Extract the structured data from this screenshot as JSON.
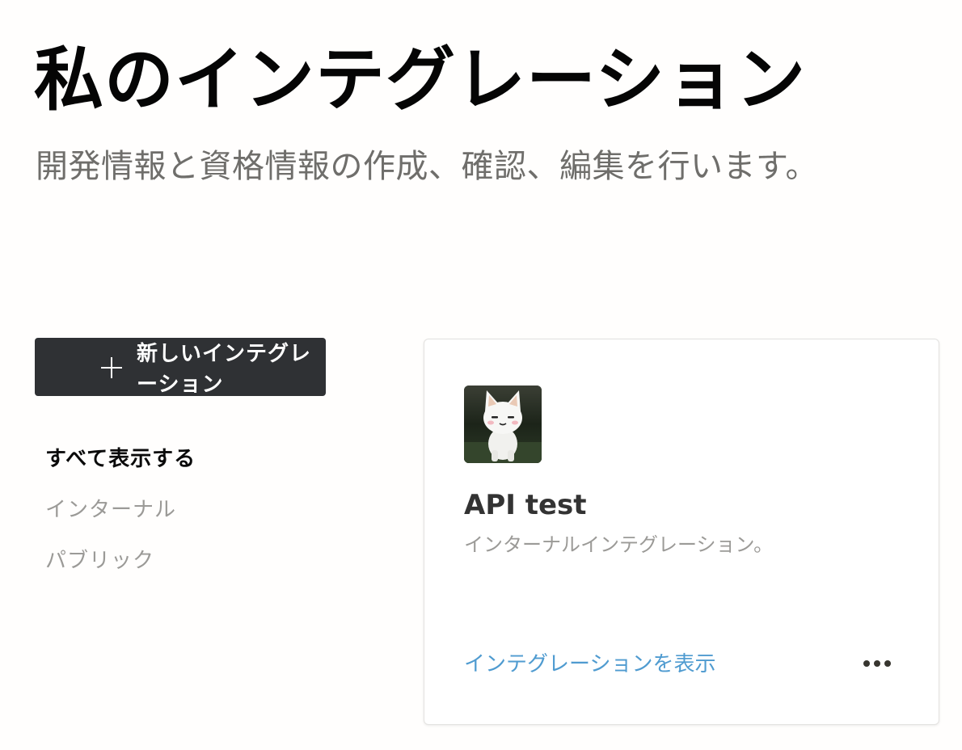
{
  "header": {
    "title": "私のインテグレーション",
    "subtitle": "開発情報と資格情報の作成、確認、編集を行います。"
  },
  "actions": {
    "new_integration_label": "新しいインテグレーション",
    "new_integration_icon": "plus-icon"
  },
  "filters": {
    "items": [
      {
        "label": "すべて表示する",
        "active": true
      },
      {
        "label": "インターナル",
        "active": false
      },
      {
        "label": "パブリック",
        "active": false
      }
    ]
  },
  "integrations": [
    {
      "name": "API test",
      "description": "インターナルインテグレーション。",
      "view_link_label": "インテグレーションを表示",
      "more_icon": "more-horizontal-icon"
    }
  ],
  "colors": {
    "button_bg": "#2f3134",
    "link": "#4f9bd0",
    "muted_text": "#9b9a97"
  }
}
